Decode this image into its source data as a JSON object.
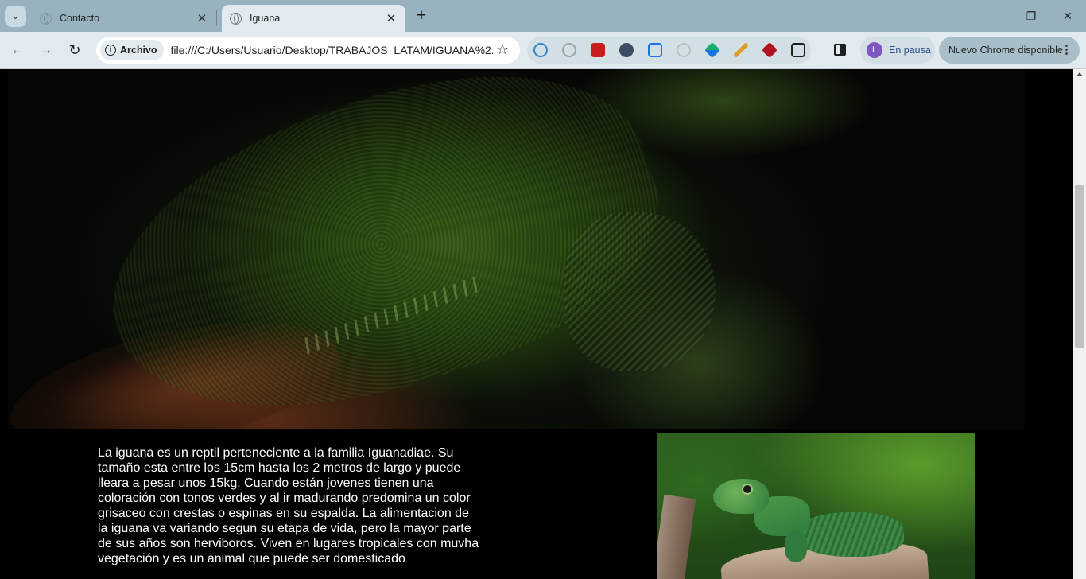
{
  "browser": {
    "tabs": [
      {
        "title": "Contacto",
        "close": "✕"
      },
      {
        "title": "Iguana",
        "close": "✕"
      }
    ],
    "tab_search_glyph": "⌄",
    "new_tab_glyph": "+",
    "window_controls": {
      "minimize": "—",
      "restore": "❐",
      "close": "✕"
    },
    "nav": {
      "back": "←",
      "forward": "→",
      "reload": "↻"
    },
    "omnibox": {
      "security_chip": "Archivo",
      "info_glyph": "i",
      "url": "file:///C:/Users/Usuario/Desktop/TRABAJOS_LATAM/IGUANA%2...",
      "star_glyph": "☆"
    },
    "extensions": [
      {
        "icon": "magnifier-extension-icon",
        "color": "#2f86c9"
      },
      {
        "icon": "record-extension-icon",
        "color": "#9aa4a9"
      },
      {
        "icon": "pdf-extension-icon",
        "color": "#c81e1e"
      },
      {
        "icon": "cursor-extension-icon",
        "color": "#3b4c63"
      },
      {
        "icon": "clipboard-extension-icon",
        "color": "#1a73e8"
      },
      {
        "icon": "link-extension-icon",
        "color": "#b8c0c4"
      },
      {
        "icon": "arrow-extension-icon",
        "color": "#17b06b"
      },
      {
        "icon": "pickaxe-extension-icon",
        "color": "#e09a2c"
      },
      {
        "icon": "diamond-extension-icon",
        "color": "#b3121f"
      },
      {
        "icon": "puzzle-extension-icon",
        "color": "#1f1f1f"
      }
    ],
    "profile": {
      "initial": "L",
      "label": "En pausa",
      "avatar_color": "#7e57c2"
    },
    "update_button": {
      "label": "Nuevo Chrome disponible",
      "menu_glyph": "⋮"
    }
  },
  "page": {
    "description": "La iguana es un reptil perteneciente a la familia Iguanadiae. Su tamaño esta entre los 15cm hasta los 2 metros de largo y puede lleara a pesar unos 15kg. Cuando están jovenes tienen una coloración con tonos verdes y al ir madurando predomina un color grisaceo con crestas o espinas en su espalda. La alimentacion de la iguana va variando segun su etapa de vida, pero la mayor parte de sus años son herviboros. Viven en lugares tropicales con muvha vegetación y es un animal que puede ser domesticado"
  }
}
